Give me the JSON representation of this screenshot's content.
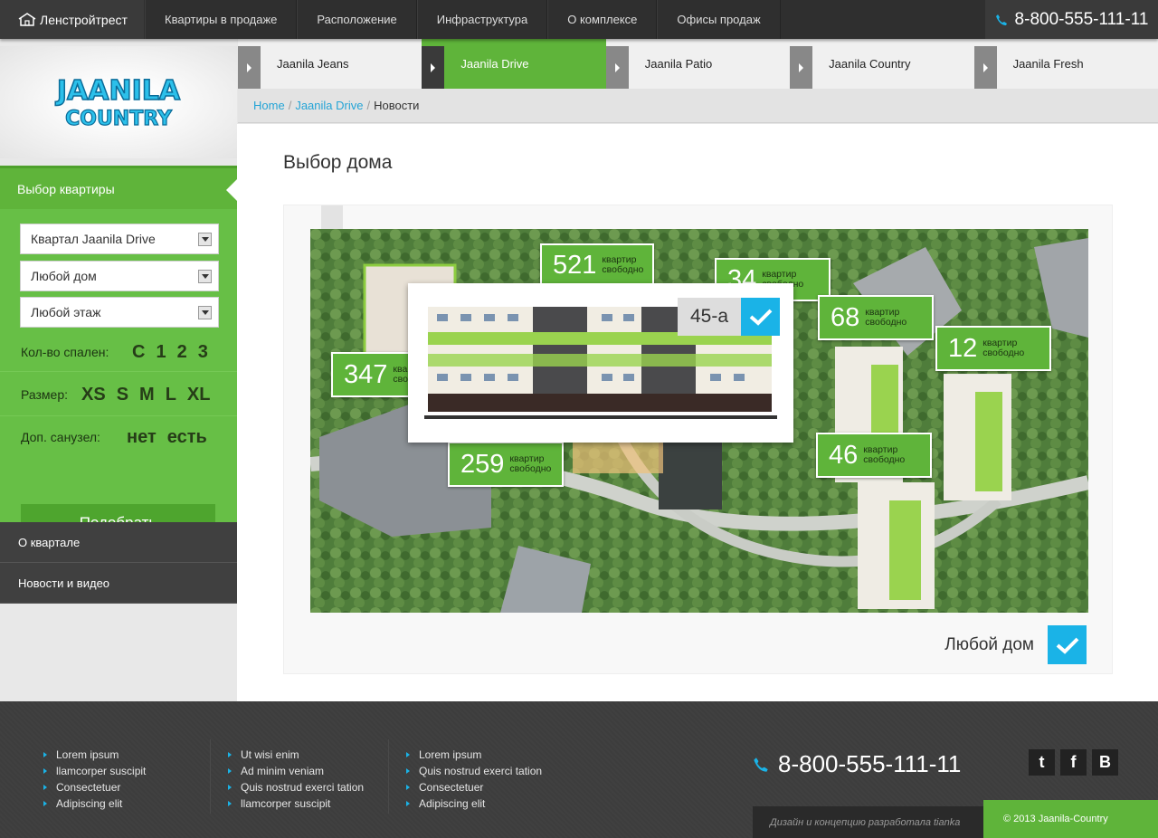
{
  "topbar": {
    "brand": "Ленстройтрест",
    "nav": [
      "Квартиры в продаже",
      "Расположение",
      "Инфраструктура",
      "О комплексе",
      "Офисы продаж"
    ],
    "phone": "8-800-555-111-11"
  },
  "logo": {
    "line1": "JAANILA",
    "line2": "COUNTRY"
  },
  "sidebar": {
    "title": "Выбор квартиры",
    "selects": [
      "Квартал Jaanila Drive",
      "Любой дом",
      "Любой этаж"
    ],
    "bedrooms_label": "Кол-во спален:",
    "bedrooms_opts": [
      "С",
      "1",
      "2",
      "3"
    ],
    "size_label": "Размер:",
    "size_opts": [
      "XS",
      "S",
      "M",
      "L",
      "XL"
    ],
    "bath_label": "Доп. санузел:",
    "bath_opts": [
      "нет",
      "есть"
    ],
    "submit": "Подобрать",
    "menu": [
      "О квартале",
      "Новости и видео"
    ]
  },
  "subtabs": [
    "Jaanila Jeans",
    "Jaanila Drive",
    "Jaanila Patio",
    "Jaanila Country",
    "Jaanila Fresh"
  ],
  "breadcrumb": {
    "home": "Home",
    "section": "Jaanila Drive",
    "current": "Новости"
  },
  "main": {
    "title": "Выбор дома",
    "any_house": "Любой дом",
    "popup_label": "45-а",
    "bubble_text_1": "квартир",
    "bubble_text_2": "свободно",
    "bubbles": [
      "521",
      "34",
      "68",
      "12",
      "347",
      "259",
      "46"
    ]
  },
  "footer": {
    "col1": [
      "Lorem ipsum",
      "llamcorper suscipit",
      "Consectetuer",
      "Adipiscing elit"
    ],
    "col2": [
      "Ut wisi enim",
      "Ad minim veniam",
      "Quis nostrud exerci tation",
      "llamcorper suscipit"
    ],
    "col3": [
      "Lorem ipsum",
      "Quis nostrud exerci tation",
      "Consectetuer",
      "Adipiscing elit"
    ],
    "phone": "8-800-555-111-11",
    "social": [
      "t",
      "f",
      "B"
    ],
    "credit": "Дизайн и концепцию разработала tianka",
    "copyright": "© 2013 Jaanila-Country"
  },
  "colors": {
    "green": "#5fb43a",
    "dark": "#2f2f2f",
    "accent_blue": "#1ab3e7"
  }
}
